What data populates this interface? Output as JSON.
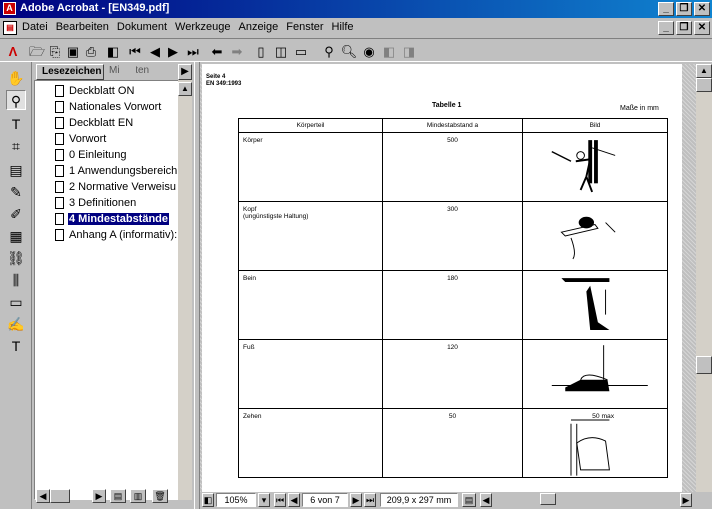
{
  "window": {
    "title": "Adobe Acrobat - [EN349.pdf]",
    "app_icon_text": "A"
  },
  "menus": [
    "Datei",
    "Bearbeiten",
    "Dokument",
    "Werkzeuge",
    "Anzeige",
    "Fenster",
    "Hilfe"
  ],
  "bookmarks": {
    "tabs": [
      "Lesezeichen",
      "Mi",
      "iten"
    ],
    "items": [
      "Deckblatt ON",
      "Nationales Vorwort",
      "Deckblatt EN",
      "Vorwort",
      "0 Einleitung",
      "1 Anwendungsbereich",
      "2 Normative Verweisu",
      "3 Definitionen",
      "4 Mindestabstände",
      "Anhang A (informativ):"
    ],
    "selected_index": 8
  },
  "document": {
    "header_line1": "Seite 4",
    "header_line2": "EN 349:1993",
    "table_title": "Tabelle 1",
    "units": "Maße in mm",
    "columns": [
      "Körperteil",
      "Mindestabstand a",
      "Bild"
    ],
    "rows": [
      {
        "part": "Körper",
        "sub": "",
        "distance": "500"
      },
      {
        "part": "Kopf",
        "sub": "(ungünstigste Haltung)",
        "distance": "300"
      },
      {
        "part": "Bein",
        "sub": "",
        "distance": "180"
      },
      {
        "part": "Fuß",
        "sub": "",
        "distance": "120"
      },
      {
        "part": "Zehen",
        "sub": "",
        "distance": "50"
      }
    ],
    "zehen_label": "50 max"
  },
  "status": {
    "zoom": "105%",
    "page": "6 von 7",
    "page_size": "209,9 x 297 mm"
  }
}
